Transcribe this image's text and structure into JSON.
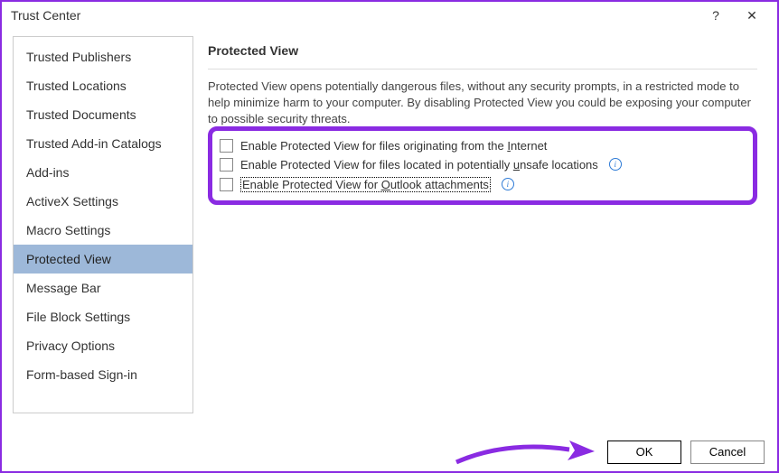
{
  "window": {
    "title": "Trust Center",
    "help": "?",
    "close": "✕"
  },
  "sidebar": {
    "items": [
      {
        "label": "Trusted Publishers"
      },
      {
        "label": "Trusted Locations"
      },
      {
        "label": "Trusted Documents"
      },
      {
        "label": "Trusted Add-in Catalogs"
      },
      {
        "label": "Add-ins"
      },
      {
        "label": "ActiveX Settings"
      },
      {
        "label": "Macro Settings"
      },
      {
        "label": "Protected View",
        "selected": true
      },
      {
        "label": "Message Bar"
      },
      {
        "label": "File Block Settings"
      },
      {
        "label": "Privacy Options"
      },
      {
        "label": "Form-based Sign-in"
      }
    ]
  },
  "main": {
    "heading": "Protected View",
    "description": "Protected View opens potentially dangerous files, without any security prompts, in a restricted mode to help minimize harm to your computer. By disabling Protected View you could be exposing your computer to possible security threats.",
    "checkboxes": [
      {
        "pre": "Enable Protected View for files originating from the ",
        "u": "I",
        "post": "nternet"
      },
      {
        "pre": "Enable Protected View for files located in potentially ",
        "u": "u",
        "post": "nsafe locations",
        "info": true
      },
      {
        "pre": "Enable Protected View for ",
        "u": "O",
        "post": "utlook attachments",
        "info": true,
        "focused": true
      }
    ]
  },
  "footer": {
    "ok": "OK",
    "cancel": "Cancel"
  }
}
